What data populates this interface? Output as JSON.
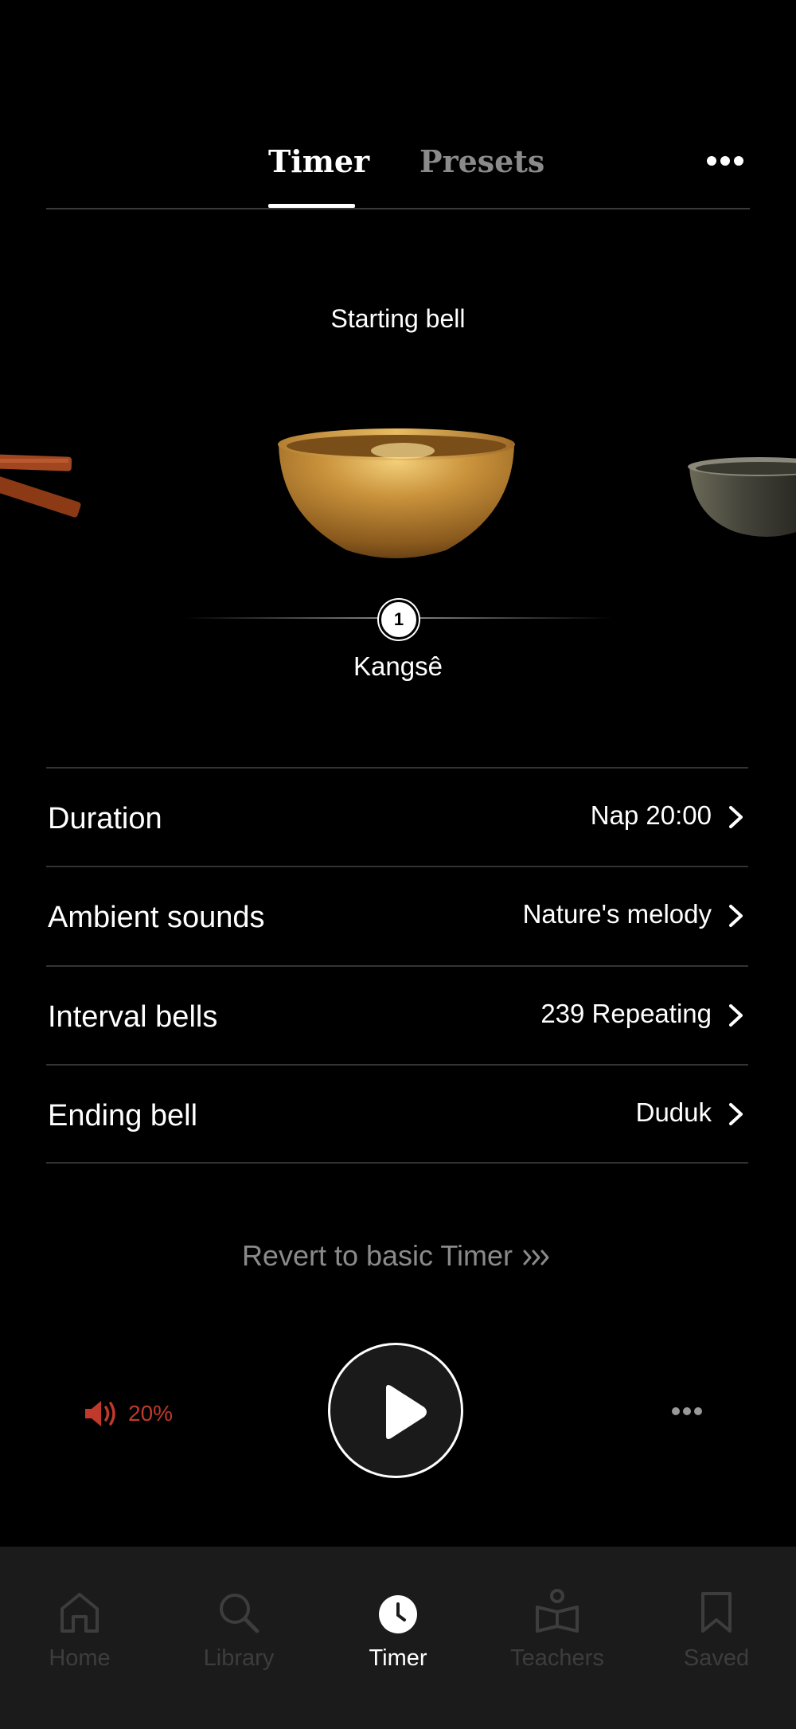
{
  "tabs": {
    "timer": "Timer",
    "presets": "Presets"
  },
  "starting_bell": {
    "label": "Starting bell",
    "selected_index": "1",
    "selected_name": "Kangsê"
  },
  "settings": [
    {
      "label": "Duration",
      "value": "Nap 20:00"
    },
    {
      "label": "Ambient sounds",
      "value": "Nature's melody"
    },
    {
      "label": "Interval bells",
      "value": "239 Repeating"
    },
    {
      "label": "Ending bell",
      "value": "Duduk"
    }
  ],
  "revert_label": "Revert to basic Timer",
  "player": {
    "volume": "20%"
  },
  "nav": [
    {
      "label": "Home",
      "icon": "home-icon"
    },
    {
      "label": "Library",
      "icon": "search-icon"
    },
    {
      "label": "Timer",
      "icon": "clock-icon"
    },
    {
      "label": "Teachers",
      "icon": "teacher-book-icon"
    },
    {
      "label": "Saved",
      "icon": "bookmark-icon"
    }
  ],
  "colors": {
    "accent_volume": "#c0392b",
    "background": "#000000",
    "nav_background": "#1b1b1b"
  }
}
